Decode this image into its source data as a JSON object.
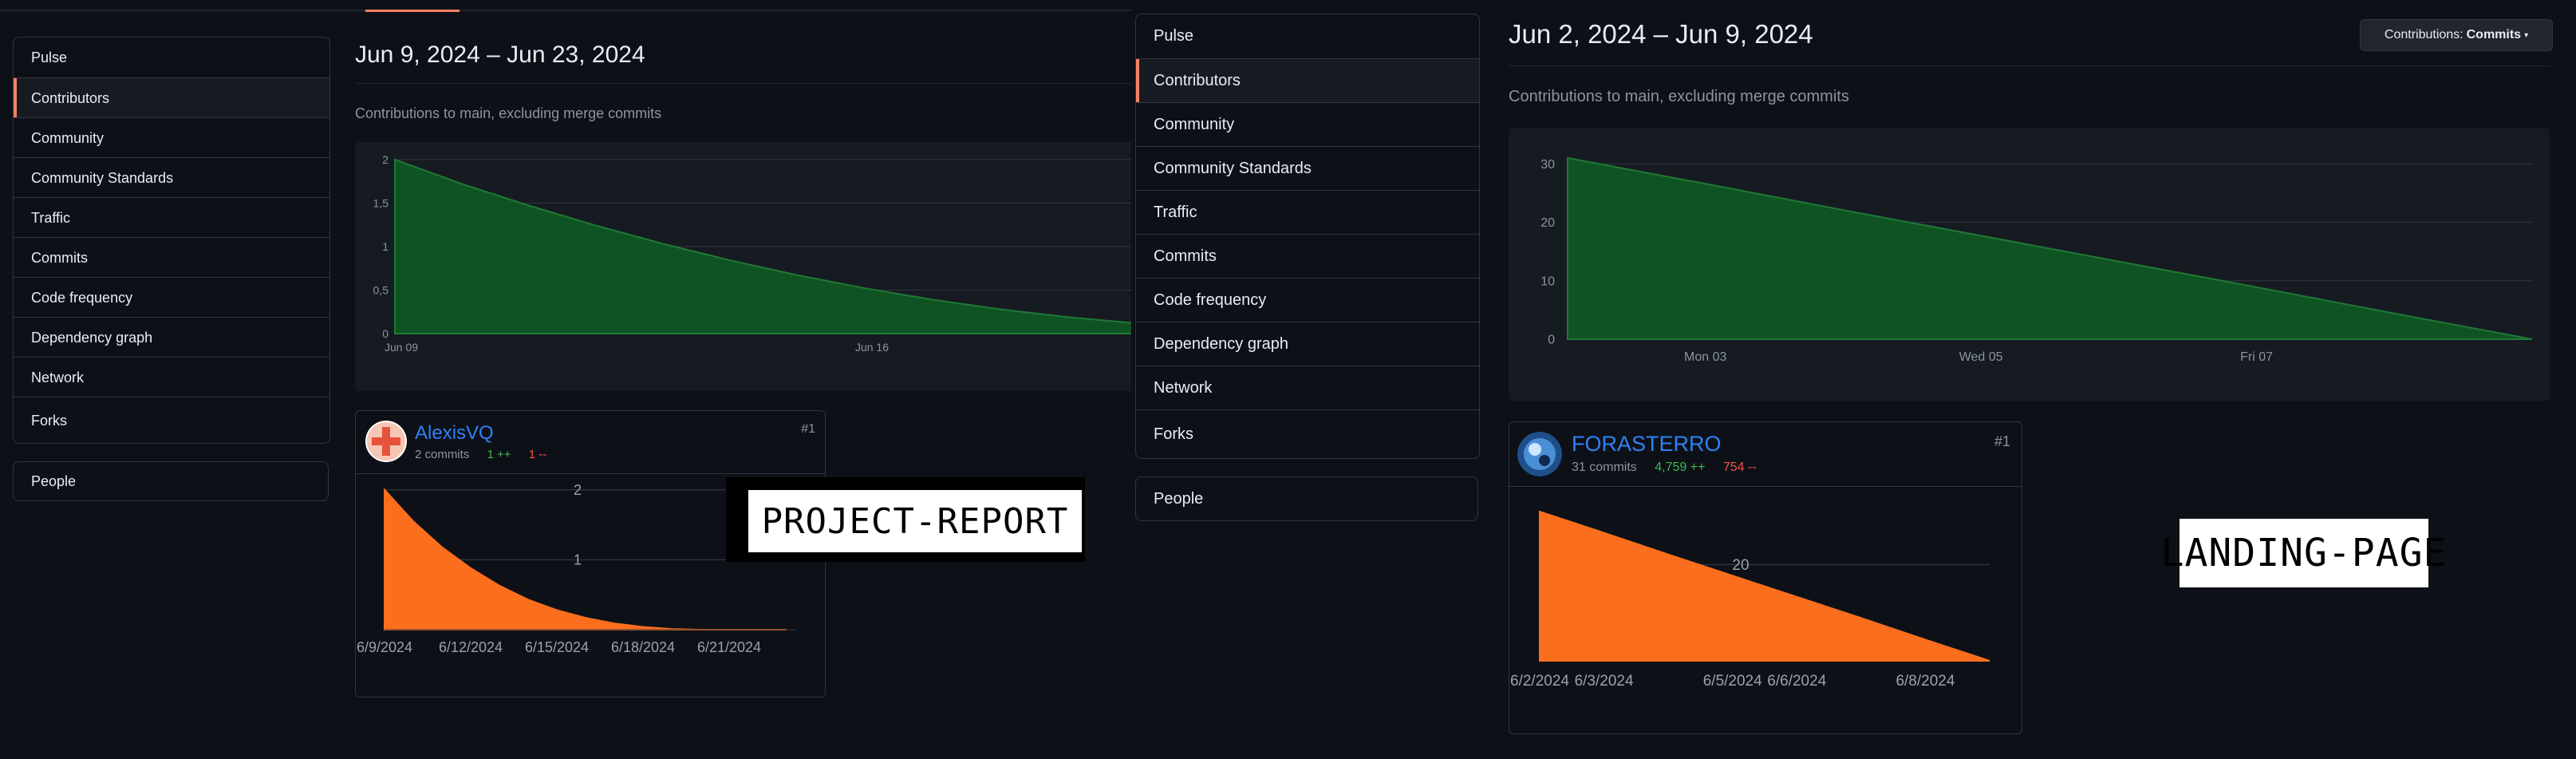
{
  "left_page": {
    "nav": [
      "Pulse",
      "Contributors",
      "Community",
      "Community Standards",
      "Traffic",
      "Commits",
      "Code frequency",
      "Dependency graph",
      "Network",
      "Forks"
    ],
    "selected_nav": "Contributors",
    "people": "People",
    "range": "Jun 9, 2024 – Jun 23, 2024",
    "subtitle": "Contributions to main, excluding merge commits",
    "chart_data": {
      "type": "area",
      "title": "",
      "x": [
        "Jun 09",
        "Jun 10",
        "Jun 11",
        "Jun 12",
        "Jun 13",
        "Jun 14",
        "Jun 15",
        "Jun 16",
        "Jun 17",
        "Jun 18",
        "Jun 19",
        "Jun 20",
        "Jun 21",
        "Jun 22",
        "Jun 23"
      ],
      "series": [
        {
          "values": [
            2,
            1.72,
            1.47,
            1.24,
            1.03,
            0.84,
            0.67,
            0.52,
            0.39,
            0.28,
            0.19,
            0.12,
            0.06,
            0.02,
            0
          ]
        }
      ],
      "x_tick_labels": [
        "Jun 09",
        "Jun 16"
      ],
      "y_tick_labels": [
        "0",
        "0,5",
        "1",
        "1,5",
        "2"
      ],
      "ylim": [
        0,
        2
      ],
      "grid": true,
      "color": "#0f5323"
    },
    "contributor": {
      "name": "AlexisVQ",
      "commits": "2 commits",
      "additions": "1 ++",
      "deletions": "1 --",
      "rank": "#1",
      "chart_data": {
        "type": "area",
        "x": [
          "6/9/2024",
          "6/10/2024",
          "6/11/2024",
          "6/12/2024",
          "6/13/2024",
          "6/14/2024",
          "6/15/2024",
          "6/16/2024",
          "6/17/2024",
          "6/18/2024",
          "6/19/2024",
          "6/20/2024",
          "6/21/2024",
          "6/22/2024",
          "6/23/2024"
        ],
        "series": [
          {
            "values": [
              2,
              1.55,
              1.18,
              0.88,
              0.63,
              0.43,
              0.28,
              0.17,
              0.09,
              0.04,
              0.01,
              0,
              0,
              0,
              0
            ]
          }
        ],
        "x_tick_labels": [
          "6/9/2024",
          "6/12/2024",
          "6/15/2024",
          "6/18/2024",
          "6/21/2024"
        ],
        "y_tick_labels": [
          "1",
          "2"
        ],
        "ylim": [
          0,
          2.1
        ],
        "color": "#fb6e1e"
      }
    },
    "sticker": "PROJECT-REPORT"
  },
  "right_page": {
    "nav": [
      "Pulse",
      "Contributors",
      "Community",
      "Community Standards",
      "Traffic",
      "Commits",
      "Code frequency",
      "Dependency graph",
      "Network",
      "Forks"
    ],
    "selected_nav": "Contributors",
    "people": "People",
    "range": "Jun 2, 2024 – Jun 9, 2024",
    "subtitle": "Contributions to main, excluding merge commits",
    "dropdown_prefix": "Contributions:",
    "dropdown_value": "Commits",
    "chart_data": {
      "type": "area",
      "title": "",
      "x": [
        "Jun 02",
        "Jun 03",
        "Jun 04",
        "Jun 05",
        "Jun 06",
        "Jun 07",
        "Jun 08",
        "Jun 09"
      ],
      "series": [
        {
          "values": [
            31,
            26.6,
            22.1,
            17.7,
            13.3,
            8.9,
            4.4,
            0
          ]
        }
      ],
      "x_tick_labels": [
        "Mon 03",
        "Wed 05",
        "Fri 07"
      ],
      "y_tick_labels": [
        "0",
        "10",
        "20",
        "30"
      ],
      "ylim": [
        0,
        31
      ],
      "grid": true,
      "color": "#0f5323"
    },
    "contributor": {
      "name": "FORASTERRO",
      "commits": "31 commits",
      "additions": "4,759 ++",
      "deletions": "754 --",
      "rank": "#1",
      "chart_data": {
        "type": "area",
        "x": [
          "6/2/2024",
          "6/3/2024",
          "6/4/2024",
          "6/5/2024",
          "6/6/2024",
          "6/7/2024",
          "6/8/2024",
          "6/9/2024"
        ],
        "series": [
          {
            "values": [
              31,
              26.6,
              22.1,
              17.7,
              13.3,
              8.9,
              4.4,
              0
            ]
          }
        ],
        "x_tick_labels": [
          "6/2/2024",
          "6/3/2024",
          "6/5/2024",
          "6/6/2024",
          "6/8/2024"
        ],
        "y_tick_labels": [
          "20"
        ],
        "ylim": [
          0,
          33
        ],
        "color": "#fb6e1e"
      }
    },
    "sticker": "LANDING-PAGE"
  }
}
